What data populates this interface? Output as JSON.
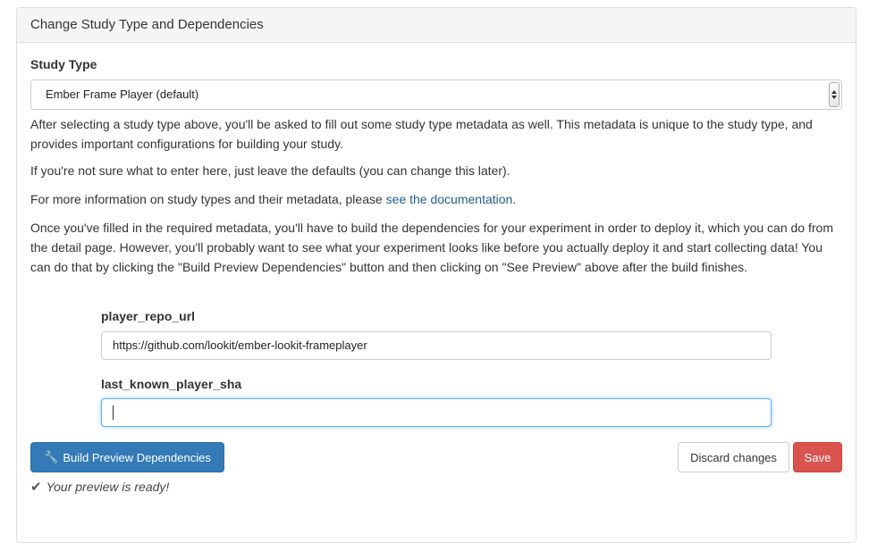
{
  "panel": {
    "heading": "Change Study Type and Dependencies"
  },
  "study_type": {
    "label": "Study Type",
    "selected": "Ember Frame Player (default)"
  },
  "help": {
    "p1": "After selecting a study type above, you'll be asked to fill out some study type metadata as well. This metadata is unique to the study type, and provides important configurations for building your study.",
    "p2": "If you're not sure what to enter here, just leave the defaults (you can change this later).",
    "p3_prefix": "For more information on study types and their metadata, please ",
    "p3_link": "see the documentation",
    "p3_suffix": ".",
    "p4": "Once you've filled in the required metadata, you'll have to build the dependencies for your experiment in order to deploy it, which you can do from the detail page. However, you'll probably want to see what your experiment looks like before you actually deploy it and start collecting data! You can do that by clicking the \"Build Preview Dependencies\" button and then clicking on \"See Preview\" above after the build finishes."
  },
  "fields": {
    "player_repo_url": {
      "label": "player_repo_url",
      "value": "https://github.com/lookit/ember-lookit-frameplayer"
    },
    "last_known_player_sha": {
      "label": "last_known_player_sha",
      "value": ""
    }
  },
  "buttons": {
    "build_preview": "Build Preview Dependencies",
    "discard": "Discard changes",
    "save": "Save"
  },
  "icons": {
    "build": "wrench-icon",
    "status": "check-icon"
  },
  "status": {
    "text": "Your preview is ready!"
  },
  "colors": {
    "primary": "#337ab7",
    "danger": "#d9534f",
    "link": "#1d5e8c",
    "focus": "#66afe9"
  }
}
